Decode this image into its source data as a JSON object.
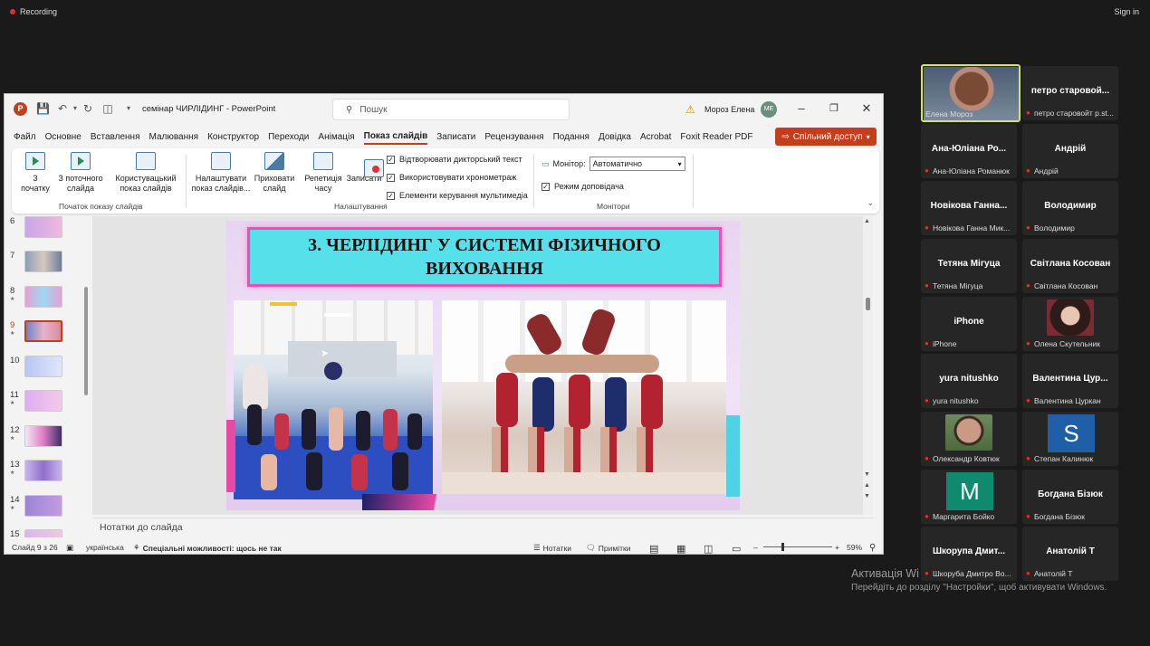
{
  "recording": {
    "label": "Recording"
  },
  "signin": {
    "label": "Sign in"
  },
  "ppt": {
    "app_logo": "P",
    "title": "семінар ЧИРЛІДИНГ  -  PowerPoint",
    "search_placeholder": "Пошук",
    "user_name": "Мороз Елена",
    "user_initials": "МЕ",
    "menu": [
      "Файл",
      "Основне",
      "Вставлення",
      "Малювання",
      "Конструктор",
      "Переходи",
      "Анімація",
      "Показ слайдів",
      "Записати",
      "Рецензування",
      "Подання",
      "Довідка",
      "Acrobat",
      "Foxit Reader PDF"
    ],
    "active_menu": "Показ слайдів",
    "share_label": "Спільний доступ",
    "ribbon": {
      "from_start": "З\nпочатку",
      "from_current": "З поточного\nслайда",
      "custom_show": "Користувацький\nпоказ слайдів",
      "group_start": "Початок показу слайдів",
      "setup_show": "Налаштувати\nпоказ слайдів...",
      "hide_slide": "Приховати\nслайд",
      "rehearse": "Репетиція\nчасу",
      "record": "Записати",
      "chk_narration": "Відтворювати дикторський текст",
      "chk_timings": "Використовувати хронометраж",
      "chk_media": "Елементи керування мультимедіа",
      "group_setup": "Налаштування",
      "monitor_label": "Монітор:",
      "monitor_value": "Автоматично",
      "presenter_view": "Режим доповідача",
      "group_monitors": "Монітори"
    },
    "thumbnails": [
      {
        "num": "6",
        "star": false
      },
      {
        "num": "7",
        "star": false
      },
      {
        "num": "8",
        "star": true
      },
      {
        "num": "9",
        "star": true,
        "active": true
      },
      {
        "num": "10",
        "star": false
      },
      {
        "num": "11",
        "star": true
      },
      {
        "num": "12",
        "star": true
      },
      {
        "num": "13",
        "star": true
      },
      {
        "num": "14",
        "star": true
      },
      {
        "num": "15",
        "star": false
      }
    ],
    "slide": {
      "title": "3. ЧЕРЛІДИНГ У СИСТЕМІ ФІЗИЧНОГО ВИХОВАННЯ"
    },
    "notes_placeholder": "Нотатки до слайда",
    "status": {
      "slide_counter": "Слайд 9 з 26",
      "language": "українська",
      "accessibility": "Спеціальні можливості: щось не так",
      "notes_btn": "Нотатки",
      "comments_btn": "Примітки",
      "zoom": "59%"
    }
  },
  "participants": [
    {
      "name": "",
      "label": "Елена Мороз",
      "speaking": true,
      "pic": "photo-woman"
    },
    {
      "name": "петро старовой...",
      "label": "петро старовойт p.st..."
    },
    {
      "name": "Ана-Юліана Ро...",
      "label": "Ана-Юліана Романюк"
    },
    {
      "name": "Андрій",
      "label": "Андрій"
    },
    {
      "name": "Новікова Ганна...",
      "label": "Новікова Ганна Мик..."
    },
    {
      "name": "Володимир",
      "label": "Володимир"
    },
    {
      "name": "Тетяна Мігуца",
      "label": "Тетяна Мігуца"
    },
    {
      "name": "Світлана Косован",
      "label": "Світлана Косован"
    },
    {
      "name": "iPhone",
      "label": "iPhone"
    },
    {
      "name": "",
      "label": "Олена Скутельник",
      "pic": "photo-woman2"
    },
    {
      "name": "yura nitushko",
      "label": "yura nitushko"
    },
    {
      "name": "Валентина Цур...",
      "label": "Валентина Цуркан"
    },
    {
      "name": "",
      "label": "Олександр Ковтюк",
      "pic": "photo-man"
    },
    {
      "name": "",
      "label": "Степан Калинюк",
      "letter": "S",
      "letter_color": "#1f5fa8"
    },
    {
      "name": "",
      "label": "Маргарита Бойко",
      "letter": "M",
      "letter_color": "#0f8a6e"
    },
    {
      "name": "Богдана Бізюк",
      "label": "Богдана Бізюк"
    },
    {
      "name": "Шкорупа Дмит...",
      "label": "Шкоруба Дмитро Во..."
    },
    {
      "name": "Анатолій Т",
      "label": "Анатолій Т"
    }
  ],
  "windows_activation": {
    "line1": "Активація Wi",
    "line2": "Перейдіть до розділу \"Настройки\", щоб активувати Windows."
  }
}
